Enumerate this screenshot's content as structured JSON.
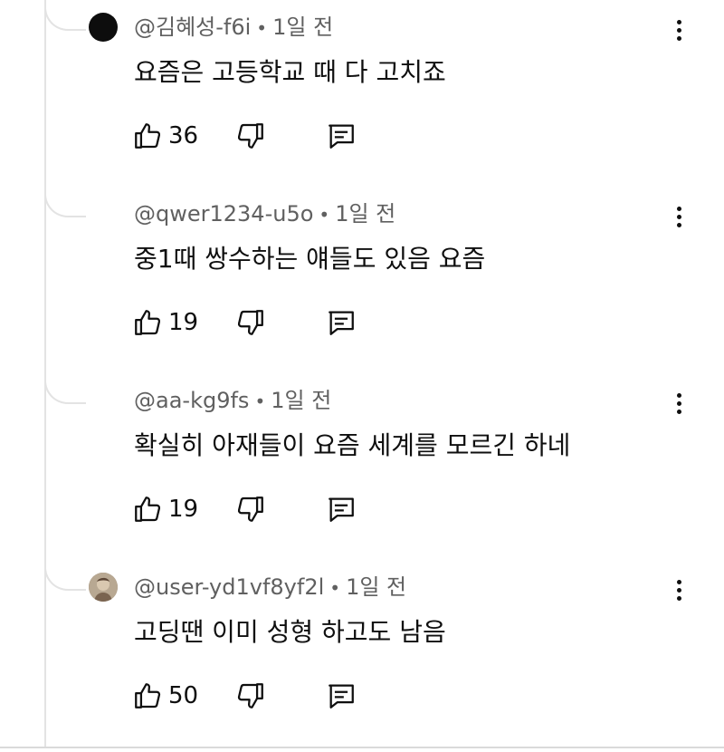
{
  "comments": [
    {
      "author": "@김혜성-f6i",
      "sep": "•",
      "time": "1일 전",
      "text": "요즘은 고등학교 때 다 고치죠",
      "likes": "36",
      "avatar": "black"
    },
    {
      "author": "@qwer1234-u5o",
      "sep": "•",
      "time": "1일 전",
      "text": "중1때 쌍수하는 얘들도 있음 요즘",
      "likes": "19",
      "avatar": "blank"
    },
    {
      "author": "@aa-kg9fs",
      "sep": "•",
      "time": "1일 전",
      "text": "확실히 아재들이 요즘 세계를 모르긴 하네",
      "likes": "19",
      "avatar": "blank"
    },
    {
      "author": "@user-yd1vf8yf2l",
      "sep": "•",
      "time": "1일 전",
      "text": "고딩땐 이미 성형 하고도 남음",
      "likes": "50",
      "avatar": "photo"
    }
  ],
  "icons": {
    "like": "thumbs-up-icon",
    "dislike": "thumbs-down-icon",
    "reply": "reply-icon",
    "more": "more-vert-icon"
  }
}
